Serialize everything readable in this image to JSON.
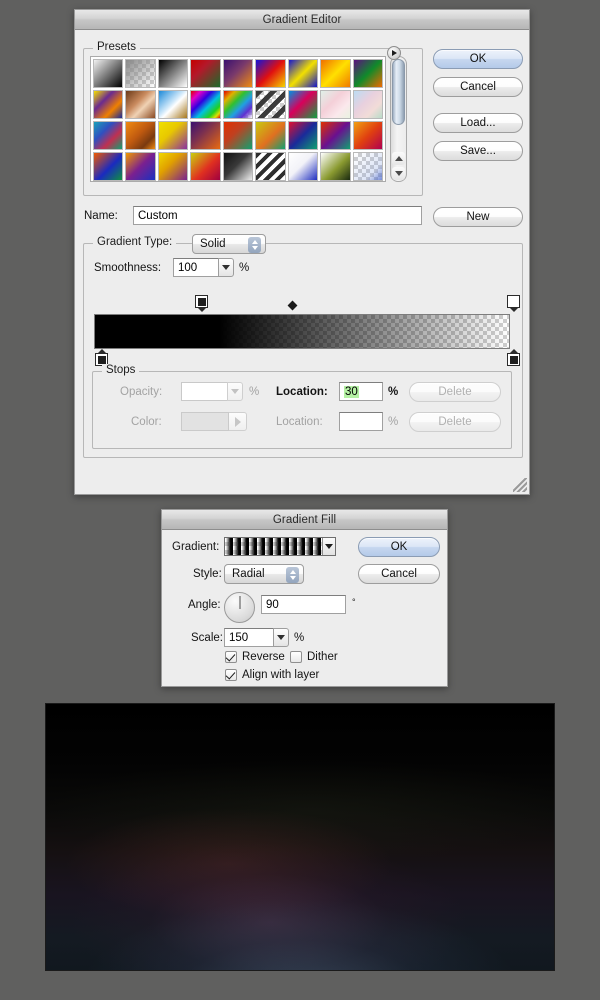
{
  "gradient_editor": {
    "title": "Gradient Editor",
    "presets": {
      "group_label": "Presets",
      "menu_icon": "disclosure-triangle-icon",
      "swatches": [
        {
          "name": "Foreground to Background",
          "css": "linear-gradient(135deg,#f2f2f2 0%,#000000 100%)"
        },
        {
          "name": "Foreground to Transparent",
          "css": "linear-gradient(135deg,#8a8a8a 0%,rgba(138,138,138,0) 100%)",
          "checker": true
        },
        {
          "name": "Black, White",
          "css": "linear-gradient(135deg,#000000 0%,#ffffff 100%)"
        },
        {
          "name": "Red, Green",
          "css": "linear-gradient(135deg,#c40000 0%,#b4182a 35%,#1a6b2a 100%)"
        },
        {
          "name": "Violet, Orange",
          "css": "linear-gradient(135deg,#3a1170 0%,#7a3a6b 45%,#f08c10 100%)"
        },
        {
          "name": "Blue, Red, Yellow",
          "css": "linear-gradient(135deg,#1414d8 0%,#e01010 50%,#f5d400 100%)"
        },
        {
          "name": "Blue, Yellow, Blue",
          "css": "linear-gradient(135deg,#1616d0 0%,#f2e000 50%,#1414c8 100%)"
        },
        {
          "name": "Orange, Yellow, Orange",
          "css": "linear-gradient(135deg,#f07000 0%,#ffe000 50%,#f07a00 100%)"
        },
        {
          "name": "Violet, Green, Orange",
          "css": "linear-gradient(135deg,#5b1080 0%,#108a2a 50%,#ef6a00 100%)"
        },
        {
          "name": "Yellow, Violet, Orange, Blue",
          "css": "linear-gradient(135deg,#f5e000 0%,#6a2a90 35%,#ef8000 68%,#1a2a9a 100%)"
        },
        {
          "name": "Copper",
          "css": "linear-gradient(135deg,#6b3a18 0%,#c98a5e 40%,#f0d2b4 60%,#8a4a22 100%)"
        },
        {
          "name": "Chrome",
          "css": "linear-gradient(135deg,#1d8ad8 0%,#cfe8fa 45%,#ffffff 55%,#a6771c 100%)"
        },
        {
          "name": "Spectrum",
          "css": "linear-gradient(135deg,#e00000 0%,#e000c8 18%,#3000e0 38%,#00c0e0 58%,#20d020 78%,#e0e000 90%,#e01010 100%)"
        },
        {
          "name": "Transparent Rainbow",
          "css": "linear-gradient(135deg,#e00000 0%,#e0b000 20%,#30c030 40%,#20a0e0 60%,#6030d0 80%,rgba(224,0,200,0) 100%)",
          "checker": true
        },
        {
          "name": "Transparent Stripes",
          "css": "repeating-linear-gradient(135deg,#3a3a3a 0px,#3a3a3a 5px,rgba(58,58,58,0) 5px,rgba(58,58,58,0) 10px)",
          "checker": true
        },
        {
          "name": "Blue, Red, Green",
          "css": "linear-gradient(135deg,#0090e0 0%,#d8005a 45%,#10a040 100%)"
        },
        {
          "name": "Pastel Pink",
          "css": "linear-gradient(135deg,#dff0e8 0%,#f4cfd8 40%,#fbe8ec 70%,#e8f2e0 100%)"
        },
        {
          "name": "Pastel Blue Green",
          "css": "linear-gradient(135deg,#bcdcf2 0%,#e8d0de 40%,#f2dcd8 70%,#b8dcc8 100%)"
        },
        {
          "name": "Blue Green Violet",
          "css": "linear-gradient(135deg,#1aa0b8 0%,#3050c0 35%,#c03050 65%,#10a070 100%)"
        },
        {
          "name": "Orange Brown",
          "css": "linear-gradient(135deg,#f08a10 0%,#c05a10 45%,#7a3a10 75%,#f08a10 100%)"
        },
        {
          "name": "Yellow Violet",
          "css": "linear-gradient(135deg,#f0e000 0%,#e8c800 40%,#8a30a0 100%)"
        },
        {
          "name": "Violet Orange",
          "css": "linear-gradient(135deg,#3a1070 0%,#7a3050 40%,#e86a10 100%)"
        },
        {
          "name": "Red Green",
          "css": "linear-gradient(135deg,#e03000 0%,#c04020 40%,#10a070 100%)"
        },
        {
          "name": "Yellow Red",
          "css": "linear-gradient(135deg,#c8c810 0%,#e07020 55%,#10a070 100%)"
        },
        {
          "name": "Red Blue",
          "css": "linear-gradient(135deg,#e01030 0%,#1a2a9a 50%,#10a070 100%)"
        },
        {
          "name": "Orange Violet",
          "css": "linear-gradient(135deg,#e03000 0%,#6a1090 50%,#10a070 100%)"
        },
        {
          "name": "Red Orange",
          "css": "linear-gradient(135deg,#f0a010 0%,#e04010 50%,#b00050 100%)"
        },
        {
          "name": "Orange Blue",
          "css": "linear-gradient(135deg,#f05a00 0%,#1a2ac0 55%,#109040 100%)"
        },
        {
          "name": "Orange Violet Blue",
          "css": "linear-gradient(135deg,#f09a00 0%,#7a2090 50%,#1a30c0 100%)"
        },
        {
          "name": "Yellow Violet 2",
          "css": "linear-gradient(135deg,#f0d800 0%,#e0a000 40%,#7a2090 100%)"
        },
        {
          "name": "Yellow Red 2",
          "css": "linear-gradient(135deg,#c8d010 0%,#e03020 55%,#a00040 100%)"
        },
        {
          "name": "Black White Fade",
          "css": "linear-gradient(135deg,#101010 0%,#3a3a3a 45%,#f0f0f0 100%)"
        },
        {
          "name": "Stripes",
          "css": "repeating-linear-gradient(135deg,#2e2e2e 0px,#2e2e2e 4px,#ffffff 4px,#ffffff 8px)"
        },
        {
          "name": "White Blue",
          "css": "linear-gradient(135deg,#ffffff 0%,#f2f2f8 45%,#2030c0 100%)"
        },
        {
          "name": "White Green Black",
          "css": "linear-gradient(135deg,#ffffff 0%,#8a9a30 55%,#1a2a10 100%)"
        },
        {
          "name": "Transparent Blue",
          "css": "linear-gradient(135deg,rgba(255,255,255,0) 0%,rgba(120,150,220,0.25) 70%,rgba(60,90,200,0.7) 100%)",
          "checker": true
        }
      ]
    },
    "name_label": "Name:",
    "name_value": "Custom",
    "new_button": "New",
    "buttons": {
      "ok": "OK",
      "cancel": "Cancel",
      "load": "Load...",
      "save": "Save..."
    },
    "gradient_type_label": "Gradient Type:",
    "gradient_type_value": "Solid",
    "smoothness_label": "Smoothness:",
    "smoothness_value": "100",
    "percent": "%",
    "degree": "°",
    "gradient_preview": {
      "description": "black to transparent",
      "css": "linear-gradient(to right, #000000 0%, #000000 30%, rgba(0,0,0,0) 100%)",
      "opacity_stops": [
        {
          "location": 30,
          "opacity": 100,
          "selected": true
        },
        {
          "location": 100,
          "opacity": 0,
          "selected": false
        }
      ],
      "color_stops": [
        {
          "location": 0,
          "color": "#000000"
        },
        {
          "location": 100,
          "color": "#000000"
        }
      ],
      "midpoint_location": 48
    },
    "stops": {
      "group_label": "Stops",
      "opacity_label": "Opacity:",
      "opacity_value": "",
      "opacity_location_label": "Location:",
      "opacity_location_value": "30",
      "color_label": "Color:",
      "color_location_label": "Location:",
      "color_location_value": "",
      "delete_label": "Delete"
    }
  },
  "gradient_fill": {
    "title": "Gradient Fill",
    "gradient_label": "Gradient:",
    "gradient_preview_css": "linear-gradient(to right, rgba(0,0,0,0) 0%, rgba(0,0,0,0) 10%, #000000 70%, #000000 100%)",
    "style_label": "Style:",
    "style_value": "Radial",
    "angle_label": "Angle:",
    "angle_value": "90",
    "degree": "°",
    "scale_label": "Scale:",
    "scale_value": "150",
    "percent": "%",
    "reverse_label": "Reverse",
    "reverse_checked": true,
    "dither_label": "Dither",
    "dither_checked": false,
    "align_label": "Align with layer",
    "align_checked": true,
    "buttons": {
      "ok": "OK",
      "cancel": "Cancel"
    }
  },
  "canvas": {
    "description": "dark radial gradient result image"
  },
  "colors": {
    "desktop": "#60605f",
    "window_face": "#ededed",
    "selection_highlight": "#b5f1a4",
    "default_button": "#b4cae9"
  }
}
